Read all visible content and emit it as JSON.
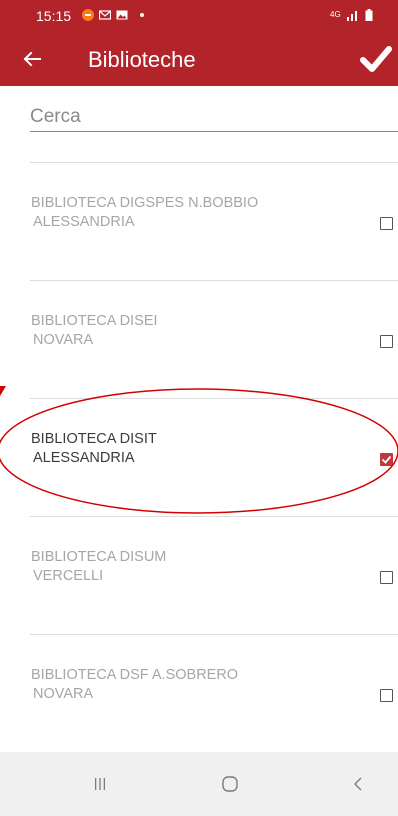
{
  "status_bar": {
    "time": "15:15",
    "network_label": "4G",
    "notification_icons": [
      "app-notification-icon",
      "mail-icon",
      "gallery-icon",
      "dot-icon"
    ]
  },
  "app_bar": {
    "title": "Biblioteche",
    "back_icon": "arrow-left-icon",
    "confirm_icon": "checkmark-icon"
  },
  "search": {
    "placeholder": "Cerca",
    "value": ""
  },
  "libraries": [
    {
      "name": "BIBLIOTECA DIGSPES N.BOBBIO",
      "city": "ALESSANDRIA",
      "checked": false
    },
    {
      "name": "BIBLIOTECA DISEI",
      "city": "NOVARA",
      "checked": false
    },
    {
      "name": "BIBLIOTECA DISIT",
      "city": "ALESSANDRIA",
      "checked": true
    },
    {
      "name": "BIBLIOTECA DISUM",
      "city": "VERCELLI",
      "checked": false
    },
    {
      "name": "BIBLIOTECA DSF A.SOBRERO",
      "city": "NOVARA",
      "checked": false
    }
  ],
  "colors": {
    "primary": "#b3232a",
    "checked": "#c0393e",
    "annotation": "#d40000",
    "text_disabled": "#a6a6a6",
    "text_active": "#3c3c3c"
  },
  "nav_bar": {
    "buttons": [
      "recents-icon",
      "home-icon",
      "back-chevron-icon"
    ]
  }
}
